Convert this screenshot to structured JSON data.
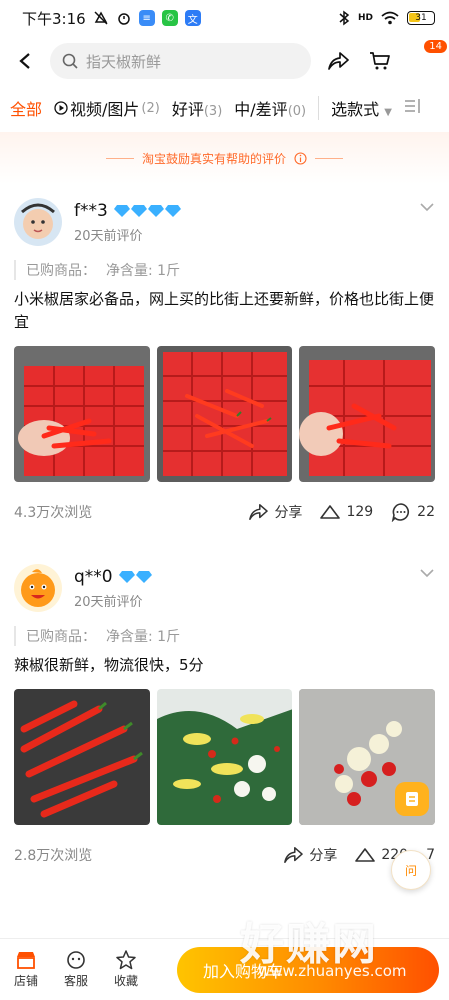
{
  "status": {
    "time": "下午3:16",
    "signal": "HD",
    "battery": "31"
  },
  "search": {
    "placeholder": "指天椒新鲜"
  },
  "cart_badge": "14",
  "tabs": [
    {
      "label": "全部",
      "count": ""
    },
    {
      "label": "视频/图片",
      "count": "(2)"
    },
    {
      "label": "好评",
      "count": "(3)"
    },
    {
      "label": "中/差评",
      "count": "(0)"
    },
    {
      "label": "选款式",
      "count": ""
    }
  ],
  "banner": "淘宝鼓励真实有帮助的评价",
  "reviews": [
    {
      "user": "f**3",
      "time": "20天前评价",
      "spec_label": "已购商品：",
      "spec_value": "净含量: 1斤",
      "text": "小米椒居家必备品，网上买的比街上还要新鲜，价格也比街上便宜",
      "views": "4.3万次浏览",
      "share": "分享",
      "likes": "129",
      "comments": "22"
    },
    {
      "user": "q**0",
      "time": "20天前评价",
      "spec_label": "已购商品：",
      "spec_value": "净含量: 1斤",
      "text": "辣椒很新鲜，物流很快，5分",
      "views": "2.8万次浏览",
      "share": "分享",
      "likes": "220",
      "comments": "7"
    }
  ],
  "bottom": {
    "store": "店铺",
    "service": "客服",
    "favorite": "收藏",
    "add_cart": "加入购物车"
  },
  "float_label": "问",
  "watermark": {
    "title": "好赚网",
    "url": "www.zhuanyes.com"
  },
  "colors": {
    "accent": "#ff5000",
    "diamond": "#3ab0ff"
  }
}
